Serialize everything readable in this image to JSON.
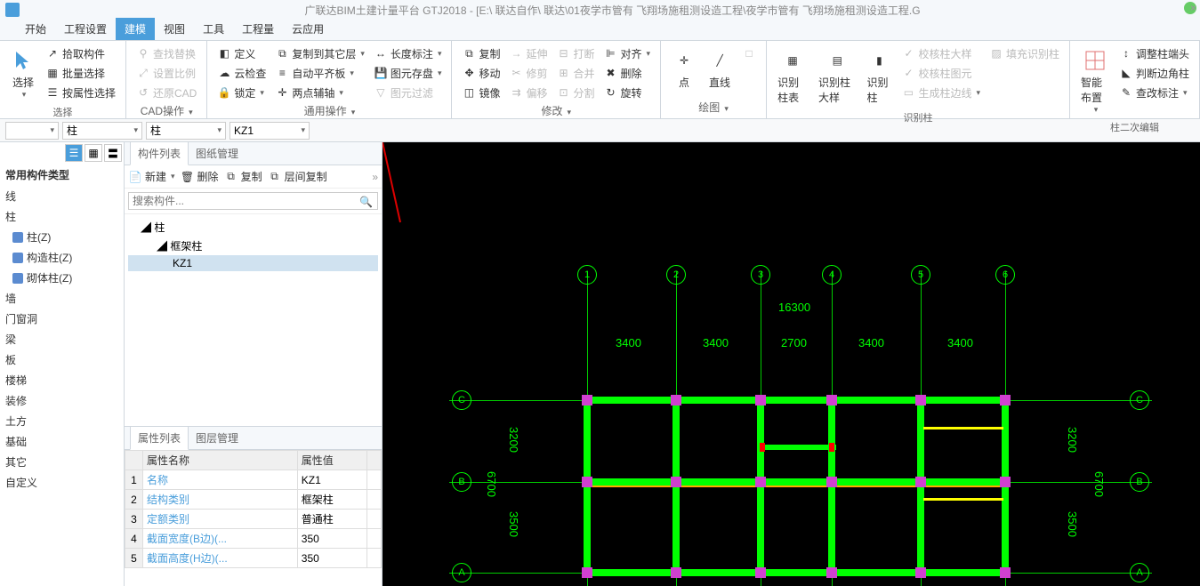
{
  "title": "广联达BIM土建计量平台 GTJ2018 - [E:\\ 联达自作\\ 联达\\01夜学市管有 飞翔场施租测设造工程\\夜学市管有 飞翔场施租测设造工程.G",
  "tabs": [
    "开始",
    "工程设置",
    "建模",
    "视图",
    "工具",
    "工程量",
    "云应用"
  ],
  "active_tab": 2,
  "ribbon": {
    "select": {
      "title": "选择",
      "btns": [
        "拾取构件",
        "批量选择",
        "按属性选择"
      ],
      "main": "选择"
    },
    "cad": {
      "title": "CAD操作",
      "btns": [
        "查找替换",
        "设置比例",
        "还原CAD"
      ]
    },
    "cloud": {
      "btns": [
        "定义",
        "云检查",
        "锁定"
      ]
    },
    "copy": {
      "btns": [
        "复制到其它层",
        "自动平齐板",
        "两点辅轴"
      ]
    },
    "length": {
      "btns": [
        "长度标注",
        "图元存盘",
        "图元过滤"
      ]
    },
    "general_title": "通用操作",
    "modify": {
      "title": "修改",
      "col1": [
        "复制",
        "移动",
        "镜像"
      ],
      "col2": [
        "延伸",
        "修剪",
        "偏移"
      ],
      "col3": [
        "打断",
        "合并",
        "分割"
      ],
      "col4": [
        "对齐",
        "删除",
        "旋转"
      ]
    },
    "draw": {
      "title": "绘图",
      "btns": [
        "点",
        "直线"
      ]
    },
    "recog": {
      "title": "识别柱",
      "btns": [
        "识别柱表",
        "识别柱大样",
        "识别柱"
      ],
      "side": [
        "校核柱大样",
        "校核柱图元",
        "生成柱边线",
        "填充识别柱"
      ]
    },
    "smart": {
      "btn": "智能布置",
      "side": [
        "调整柱端头",
        "判断边角柱",
        "查改标注"
      ],
      "title": "柱二次编辑"
    }
  },
  "sub_bar": {
    "sel1": "",
    "sel2": "柱",
    "sel3": "柱",
    "sel4": "KZ1"
  },
  "left": {
    "title": "常用构件类型",
    "items": [
      "线",
      "柱",
      "柱(Z)",
      "构造柱(Z)",
      "砌体柱(Z)",
      "墙",
      "门窗洞",
      "梁",
      "板",
      "楼梯",
      "装修",
      "土方",
      "基础",
      "其它",
      "自定义"
    ]
  },
  "mid": {
    "tabs": [
      "构件列表",
      "图纸管理"
    ],
    "toolbar": [
      "新建",
      "删除",
      "复制",
      "层间复制"
    ],
    "search_placeholder": "搜索构件...",
    "tree": {
      "root": "柱",
      "l2": "框架柱",
      "l3": "KZ1"
    }
  },
  "props": {
    "tabs": [
      "属性列表",
      "图层管理"
    ],
    "headers": [
      "",
      "属性名称",
      "属性值",
      ""
    ],
    "rows": [
      [
        "1",
        "名称",
        "KZ1"
      ],
      [
        "2",
        "结构类别",
        "框架柱"
      ],
      [
        "3",
        "定额类别",
        "普通柱"
      ],
      [
        "4",
        "截面宽度(B边)(...",
        "350"
      ],
      [
        "5",
        "截面高度(H边)(...",
        "350"
      ]
    ]
  },
  "chart_data": {
    "type": "diagram",
    "v_axes": [
      "1",
      "2",
      "3",
      "4",
      "5",
      "6"
    ],
    "h_axes": [
      "A",
      "B",
      "C"
    ],
    "top_span_total": "16300",
    "top_spans": [
      "3400",
      "3400",
      "2700",
      "3400",
      "3400"
    ],
    "left_spans": [
      "3200",
      "3500"
    ],
    "left_total": "6700",
    "right_spans": [
      "3200",
      "3500"
    ],
    "right_total": "6700"
  }
}
